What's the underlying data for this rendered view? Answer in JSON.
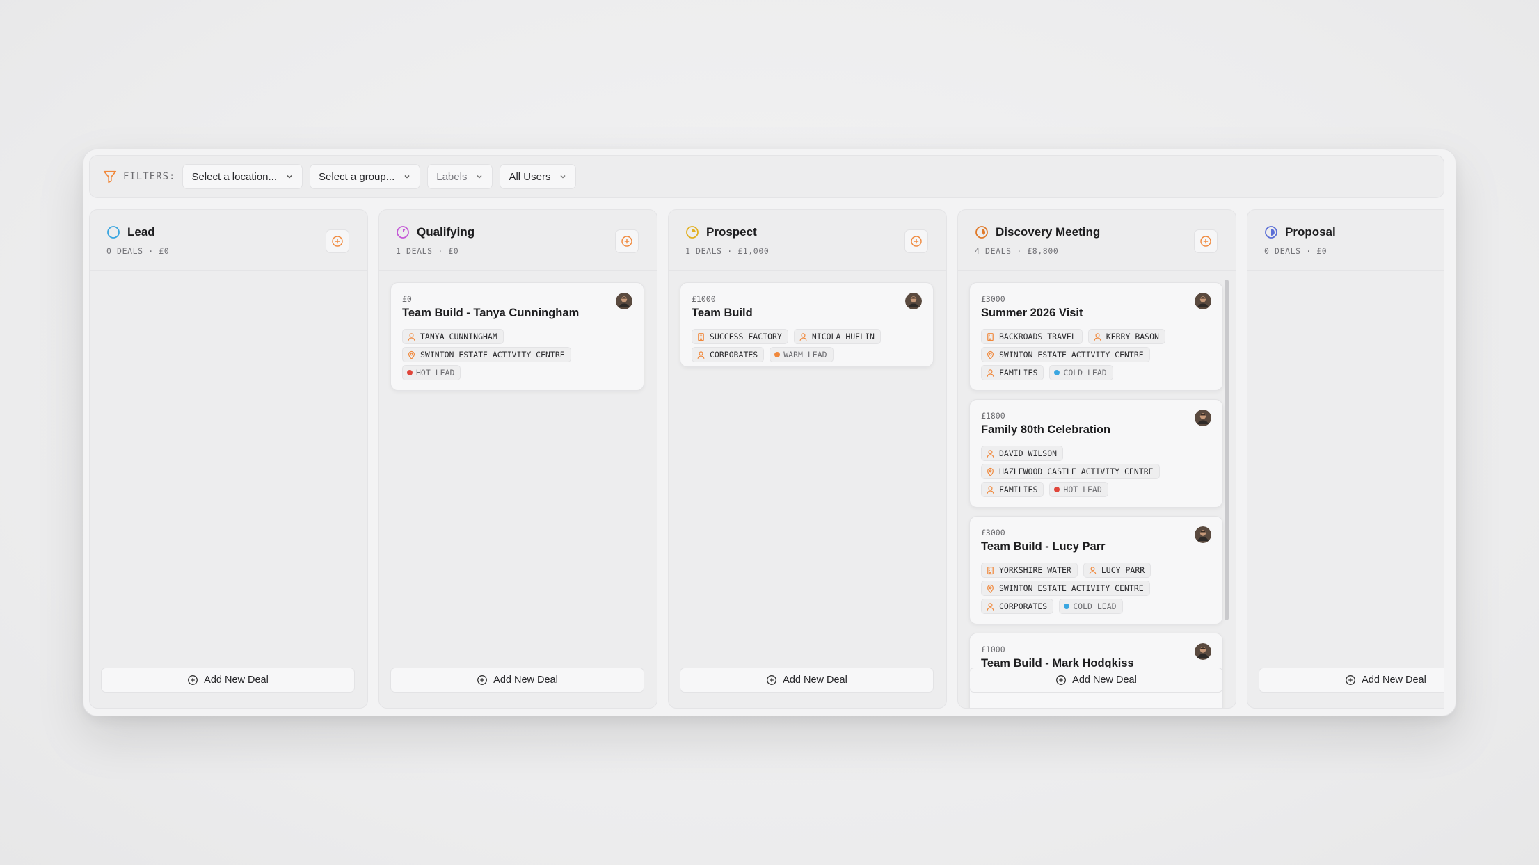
{
  "filters": {
    "label": "FILTERS:",
    "location": "Select a location...",
    "group": "Select a group...",
    "labels": "Labels",
    "users": "All Users"
  },
  "colors": {
    "hot": "#e0453a",
    "warm": "#f0883b",
    "cold": "#3aa6e0",
    "accent": "#f0883b"
  },
  "add_deal_label": "Add New Deal",
  "columns": [
    {
      "name": "Lead",
      "summary": "0 DEALS · £0",
      "icon": "circle-icon",
      "color": "#3aa6e0",
      "cards": []
    },
    {
      "name": "Qualifying",
      "summary": "1 DEALS · £0",
      "icon": "progress-icon",
      "color": "#c45ad6",
      "cards": [
        {
          "amount": "£0",
          "title": "Team Build - Tanya Cunningham",
          "tags": [
            [
              {
                "type": "person",
                "text": "TANYA CUNNINGHAM"
              }
            ],
            [
              {
                "type": "location",
                "text": "SWINTON ESTATE ACTIVITY CENTRE"
              }
            ],
            [
              {
                "type": "lead",
                "level": "hot",
                "text": "HOT LEAD"
              }
            ]
          ]
        }
      ]
    },
    {
      "name": "Prospect",
      "summary": "1 DEALS · £1,000",
      "icon": "progress-icon",
      "color": "#e2b021",
      "cards": [
        {
          "amount": "£1000",
          "title": "Team Build",
          "tags": [
            [
              {
                "type": "company",
                "text": "SUCCESS FACTORY"
              },
              {
                "type": "person",
                "text": "NICOLA HUELIN"
              }
            ],
            [
              {
                "type": "group",
                "text": "CORPORATES"
              },
              {
                "type": "lead",
                "level": "warm",
                "text": "WARM LEAD"
              }
            ]
          ]
        }
      ]
    },
    {
      "name": "Discovery Meeting",
      "summary": "4 DEALS · £8,800",
      "icon": "progress-icon",
      "color": "#e07a2a",
      "cards": [
        {
          "amount": "£3000",
          "title": "Summer 2026 Visit",
          "tags": [
            [
              {
                "type": "company",
                "text": "BACKROADS TRAVEL"
              },
              {
                "type": "person",
                "text": "KERRY BASON"
              }
            ],
            [
              {
                "type": "location",
                "text": "SWINTON ESTATE ACTIVITY CENTRE"
              }
            ],
            [
              {
                "type": "group",
                "text": "FAMILIES"
              },
              {
                "type": "lead",
                "level": "cold",
                "text": "COLD LEAD"
              }
            ]
          ]
        },
        {
          "amount": "£1800",
          "title": "Family 80th Celebration",
          "tags": [
            [
              {
                "type": "person",
                "text": "DAVID WILSON"
              }
            ],
            [
              {
                "type": "location",
                "text": "HAZLEWOOD CASTLE ACTIVITY CENTRE"
              }
            ],
            [
              {
                "type": "group",
                "text": "FAMILIES"
              },
              {
                "type": "lead",
                "level": "hot",
                "text": "HOT LEAD"
              }
            ]
          ]
        },
        {
          "amount": "£3000",
          "title": "Team Build - Lucy Parr",
          "tags": [
            [
              {
                "type": "company",
                "text": "YORKSHIRE WATER"
              },
              {
                "type": "person",
                "text": "LUCY PARR"
              }
            ],
            [
              {
                "type": "location",
                "text": "SWINTON ESTATE ACTIVITY CENTRE"
              }
            ],
            [
              {
                "type": "group",
                "text": "CORPORATES"
              },
              {
                "type": "lead",
                "level": "cold",
                "text": "COLD LEAD"
              }
            ]
          ]
        },
        {
          "amount": "£1000",
          "title": "Team Build - Mark Hodgkiss",
          "tags": []
        }
      ]
    },
    {
      "name": "Proposal",
      "summary": "0 DEALS · £0",
      "icon": "progress-icon",
      "color": "#5b6fd6",
      "cards": []
    }
  ]
}
